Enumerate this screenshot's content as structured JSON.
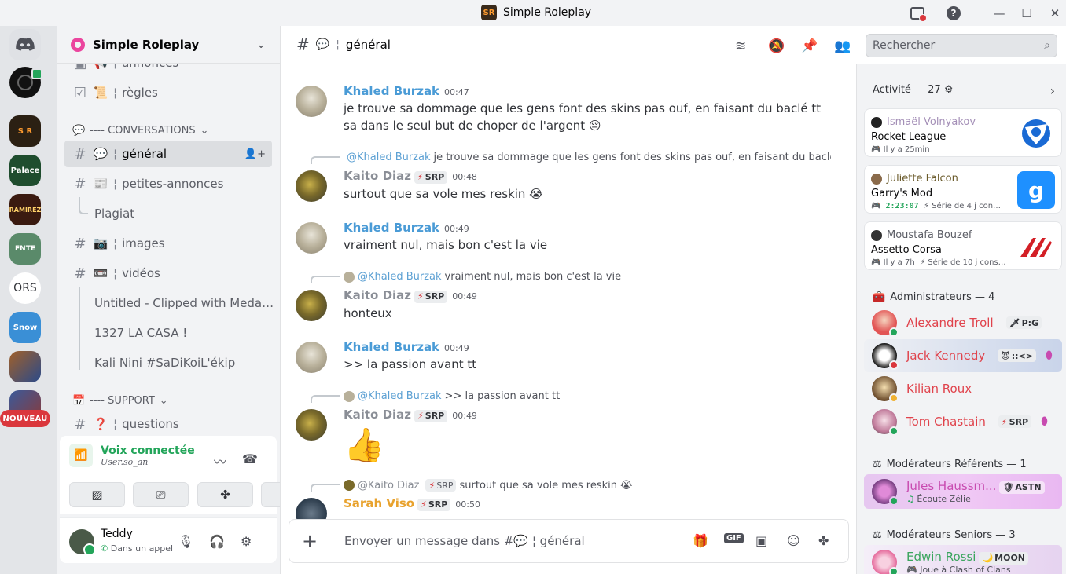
{
  "window": {
    "title": "Simple Roleplay",
    "minimize": "—",
    "maximize": "☐",
    "close": "✕"
  },
  "rail": {
    "servers": [
      {
        "name": "discord-home",
        "label": ""
      },
      {
        "name": "server-dark",
        "label": ""
      },
      {
        "name": "server-simple-roleplay",
        "label": "S R"
      },
      {
        "name": "server-palace",
        "label": "Palace"
      },
      {
        "name": "server-ramirez",
        "label": "RAMIREZ"
      },
      {
        "name": "server-fnte",
        "label": "FNTE"
      },
      {
        "name": "server-ors",
        "label": "ORS"
      },
      {
        "name": "server-snow",
        "label": "Snow"
      },
      {
        "name": "server-game",
        "label": ""
      },
      {
        "name": "server-extra",
        "label": ""
      }
    ],
    "new_badge": "NOUVEAU"
  },
  "guild": {
    "name": "Simple Roleplay"
  },
  "channels": {
    "annonces": {
      "emoji": "📢",
      "sep": "¦",
      "label": "annonces"
    },
    "regles": {
      "emoji": "📜",
      "sep": "¦",
      "label": "règles"
    },
    "cat_conversations": "---- CONVERSATIONS",
    "general": {
      "emoji": "💬",
      "sep": "¦",
      "label": "général"
    },
    "petites": {
      "emoji": "📰",
      "sep": "¦",
      "label": "petites-annonces"
    },
    "thread_plagiat": "Plagiat",
    "images": {
      "emoji": "📷",
      "sep": "¦",
      "label": "images"
    },
    "videos": {
      "emoji": "📼",
      "sep": "¦",
      "label": "vidéos"
    },
    "thread_untitled": "Untitled - Clipped with Meda…",
    "thread_casa": "1327 LA CASA !",
    "thread_kali": "Kali Nini #SaDiKoiL'ékip",
    "cat_support": "---- SUPPORT",
    "questions": {
      "emoji": "❓",
      "sep": "¦",
      "label": "questions"
    }
  },
  "voice": {
    "title": "Voix connectée",
    "subtitle": "User.so_an"
  },
  "user": {
    "name": "Teddy",
    "status": "Dans un appel"
  },
  "chat": {
    "channel_emoji": "💬",
    "channel_sep": "¦",
    "channel_name": "général",
    "search_placeholder": "Rechercher",
    "composer_placeholder": "Envoyer un message dans #💬 ¦ général",
    "messages": [
      {
        "author": "Khaled Burzak",
        "time": "00:47",
        "text": "je trouve sa dommage que les gens font des skins pas ouf, en faisant du baclé tt sa dans le seul but de choper de l'argent 😔"
      },
      {
        "reply_to": "@Khaled Burzak",
        "reply_text": "je trouve sa dommage que les gens font des skins pas ouf, en faisant du baclé t…",
        "author": "Kaito Diaz",
        "tag": "SRP",
        "time": "00:48",
        "text": "surtout que sa vole mes reskin 😭"
      },
      {
        "author": "Khaled Burzak",
        "time": "00:49",
        "text": "vraiment nul, mais bon c'est la vie"
      },
      {
        "reply_to": "@Khaled Burzak",
        "reply_text": "vraiment nul, mais bon c'est la vie",
        "author": "Kaito Diaz",
        "tag": "SRP",
        "time": "00:49",
        "text": "honteux"
      },
      {
        "author": "Khaled Burzak",
        "time": "00:49",
        "text": ">> la passion avant tt"
      },
      {
        "reply_to": "@Khaled Burzak",
        "reply_text": ">> la passion avant tt",
        "author": "Kaito Diaz",
        "tag": "SRP",
        "time": "00:49",
        "text": "👍"
      },
      {
        "reply_to": "@Kaito Diaz",
        "reply_tag": "SRP",
        "reply_text": "surtout que sa vole mes reskin 😭",
        "author": "Sarah Viso",
        "tag": "SRP",
        "time": "00:50",
        "text": ""
      }
    ]
  },
  "members": {
    "activity_header": "Activité — 27",
    "activities": [
      {
        "user": "Ismaël Volnyakov",
        "game": "Rocket League",
        "meta": "Il y a 25min"
      },
      {
        "user": "Juliette Falcon",
        "game": "Garry's Mod",
        "meta": "2:23:07",
        "meta2": "Série de 4 j con…",
        "icon": "g"
      },
      {
        "user": "Moustafa Bouzef",
        "game": "Assetto Corsa",
        "meta": "Il y a 7h",
        "meta2": "Série de 10 j cons…"
      }
    ],
    "groups": [
      {
        "title": "Administrateurs — 4"
      },
      {
        "title": "Modérateurs Référents — 1"
      },
      {
        "title": "Modérateurs Seniors — 3"
      }
    ],
    "admins": [
      {
        "name": "Alexandre Troll",
        "tag": "P:G"
      },
      {
        "name": "Jack Kennedy",
        "tag": "::<>"
      },
      {
        "name": "Kilian Roux",
        "tag": ""
      },
      {
        "name": "Tom Chastain",
        "tag": "SRP"
      }
    ],
    "referents": [
      {
        "name": "Jules Haussm...",
        "tag": "ASTN",
        "sub": "Écoute Zélie"
      }
    ],
    "seniors": [
      {
        "name": "Edwin Rossi",
        "tag": "MOON",
        "sub": "Joue à Clash of Clans"
      }
    ]
  },
  "colors": {
    "accent_green": "#23a55a",
    "link_blue": "#4a9bd6",
    "danger": "#da373c"
  }
}
